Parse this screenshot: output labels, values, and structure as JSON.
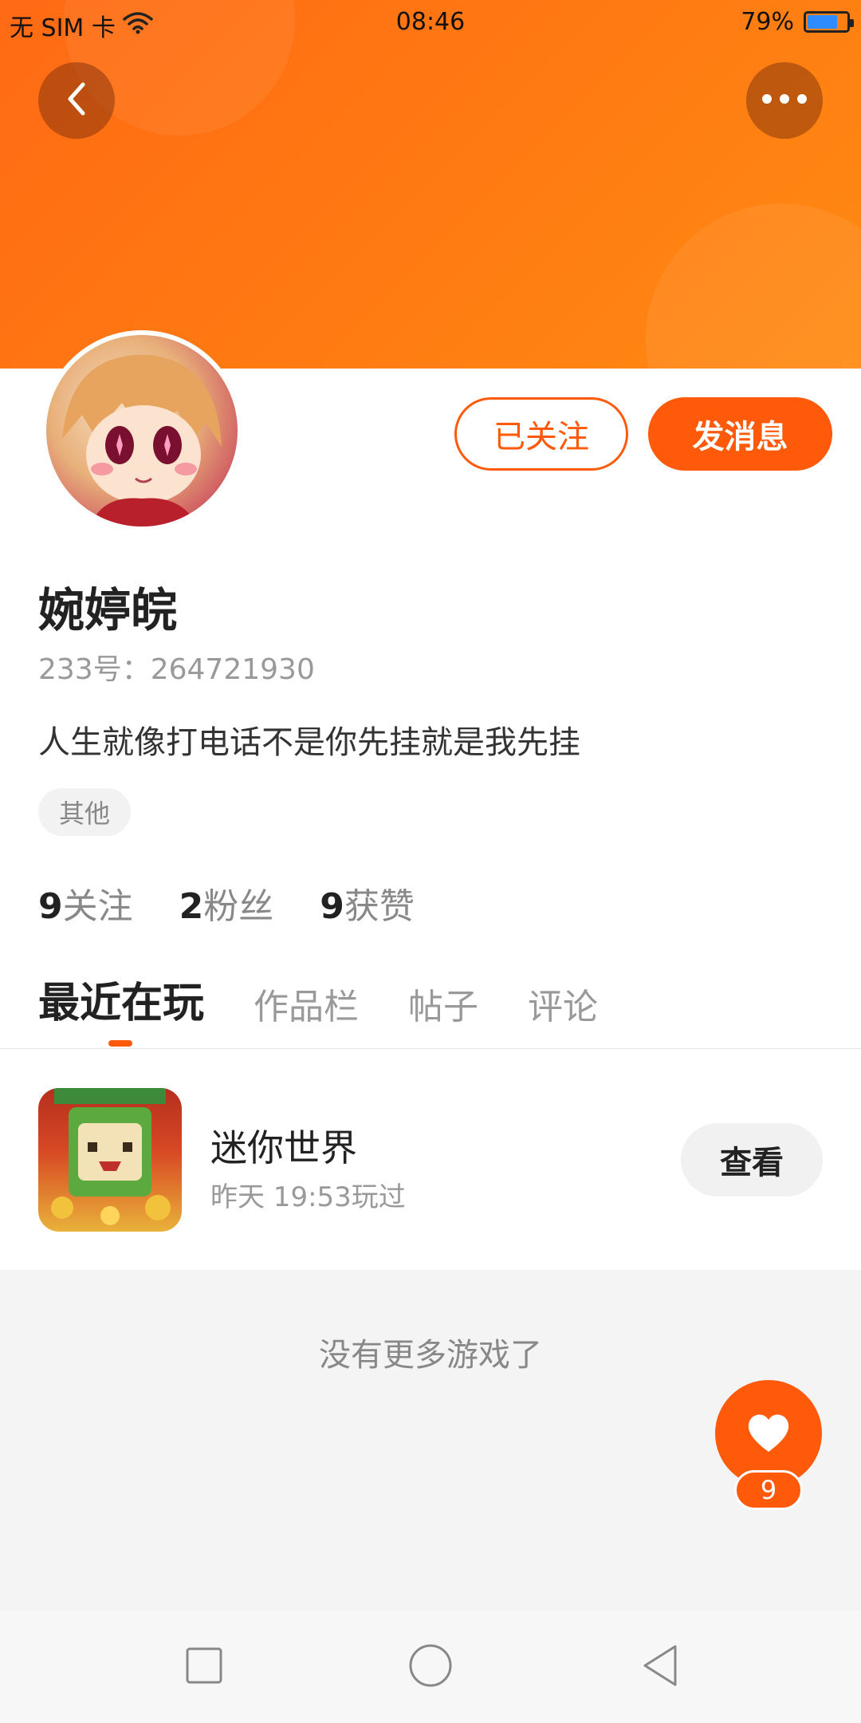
{
  "status_bar": {
    "carrier": "无 SIM 卡",
    "time": "08:46",
    "battery_percent": "79%",
    "battery_level": 0.79
  },
  "header": {
    "back_icon": "chevron-left-icon",
    "more_icon": "more-horizontal-icon"
  },
  "profile": {
    "nickname": "婉婷皖",
    "user_id": "233号：264721930",
    "bio": "人生就像打电话不是你先挂就是我先挂",
    "tag": "其他",
    "followed_label": "已关注",
    "message_label": "发消息",
    "stats": [
      {
        "num": "9",
        "label": "关注"
      },
      {
        "num": "2",
        "label": "粉丝"
      },
      {
        "num": "9",
        "label": "获赞"
      }
    ]
  },
  "tabs": [
    "最近在玩",
    "作品栏",
    "帖子",
    "评论"
  ],
  "games": [
    {
      "name": "迷你世界",
      "time": "昨天 19:53玩过",
      "action": "查看"
    }
  ],
  "empty_text": "没有更多游戏了",
  "like": {
    "count": "9",
    "icon": "heart-icon"
  },
  "nav": [
    "square-icon",
    "circle-icon",
    "triangle-back-icon"
  ],
  "colors": {
    "accent": "#ff5a0a",
    "banner": "#ff7b12"
  }
}
